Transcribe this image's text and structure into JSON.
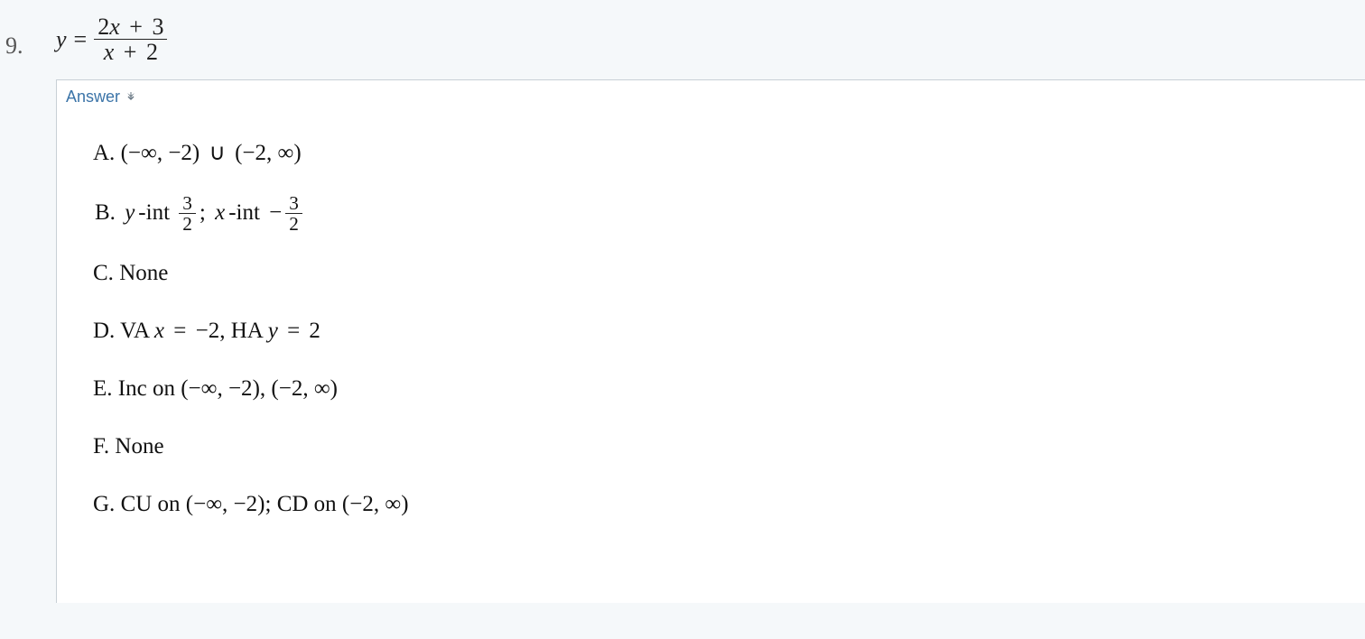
{
  "question": {
    "number": "9.",
    "lhs_var": "y",
    "equals": "=",
    "frac_num_coef": "2",
    "frac_num_var": "x",
    "frac_num_op": "+",
    "frac_num_const": "3",
    "frac_den_var": "x",
    "frac_den_op": "+",
    "frac_den_const": "2"
  },
  "answer": {
    "header": "Answer",
    "items": {
      "A": {
        "label": "A.",
        "open1": "(",
        "neg_inf1": "−∞",
        "comma1": ",",
        "neg2_1": "−2",
        "close1": ")",
        "union": "∪",
        "open2": "(",
        "neg2_2": "−2",
        "comma2": ",",
        "inf2": "∞",
        "close2": ")"
      },
      "B": {
        "label": "B.",
        "yint_var": "y",
        "yint_text": "-int",
        "yint_num": "3",
        "yint_den": "2",
        "sep": ";",
        "xint_var": "x",
        "xint_text": "-int",
        "minus": "−",
        "xint_num": "3",
        "xint_den": "2"
      },
      "C": {
        "label": "C.",
        "text": "None"
      },
      "D": {
        "label": "D.",
        "va_text": "VA",
        "va_var": "x",
        "va_eq": "=",
        "va_val": "−2",
        "comma": ",",
        "ha_text": "HA",
        "ha_var": "y",
        "ha_eq": "=",
        "ha_val": "2"
      },
      "E": {
        "label": "E.",
        "inc_text": "Inc on",
        "open1": "(",
        "neg_inf1": "−∞",
        "comma1": ",",
        "neg2_1": "−2",
        "close1": ")",
        "sep": ",",
        "open2": "(",
        "neg2_2": "−2",
        "comma2": ",",
        "inf2": "∞",
        "close2": ")"
      },
      "F": {
        "label": "F.",
        "text": "None"
      },
      "G": {
        "label": "G.",
        "cu_text": "CU on",
        "open1": "(",
        "neg_inf1": "−∞",
        "comma1": ",",
        "neg2_1": "−2",
        "close1": ")",
        "sep": ";",
        "cd_text": "CD on",
        "open2": "(",
        "neg2_2": "−2",
        "comma2": ",",
        "inf2": "∞",
        "close2": ")"
      }
    }
  }
}
